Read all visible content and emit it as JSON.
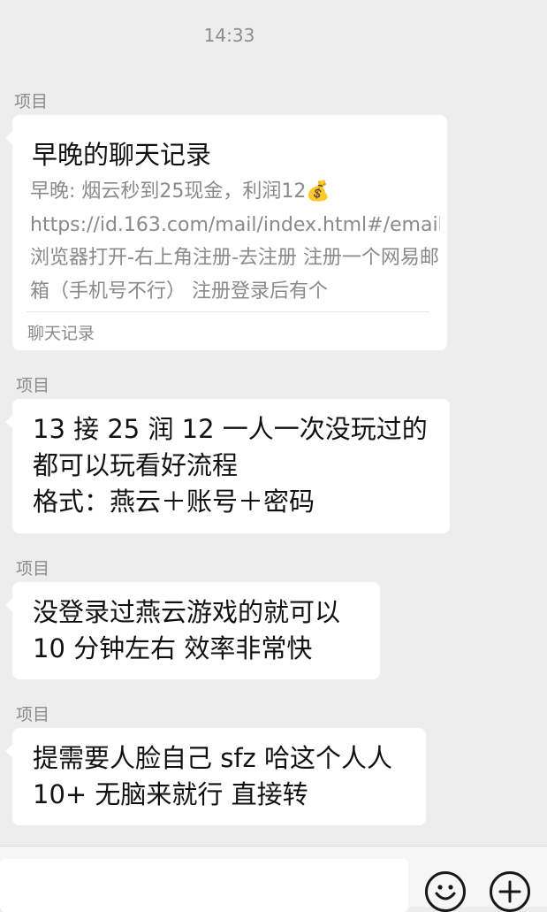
{
  "time": "14:33",
  "messages": [
    {
      "sender": "项目",
      "type": "chat-record",
      "title": "早晚的聊天记录",
      "body": "早晚: 烟云秒到25现金，利润12💰 https://id.163.com/mail/index.html#/email 浏览器打开-右上角注册-去注册 注册一个网易邮箱（手机号不行） 注册登录后有个",
      "footer": "聊天记录"
    },
    {
      "sender": "项目",
      "type": "text",
      "text": "13 接 25 润 12 一人一次没玩过的\n都可以玩看好流程\n格式：燕云＋账号＋密码"
    },
    {
      "sender": "项目",
      "type": "text",
      "text": "没登录过燕云游戏的就可以\n10 分钟左右 效率非常快"
    },
    {
      "sender": "项目",
      "type": "text",
      "text": "提需要人脸自己 sfz 哈这个人人\n10+ 无脑来就行 直接转"
    }
  ],
  "input": {
    "value": "",
    "emoji_icon": "emoji-icon",
    "plus_icon": "plus-icon"
  }
}
